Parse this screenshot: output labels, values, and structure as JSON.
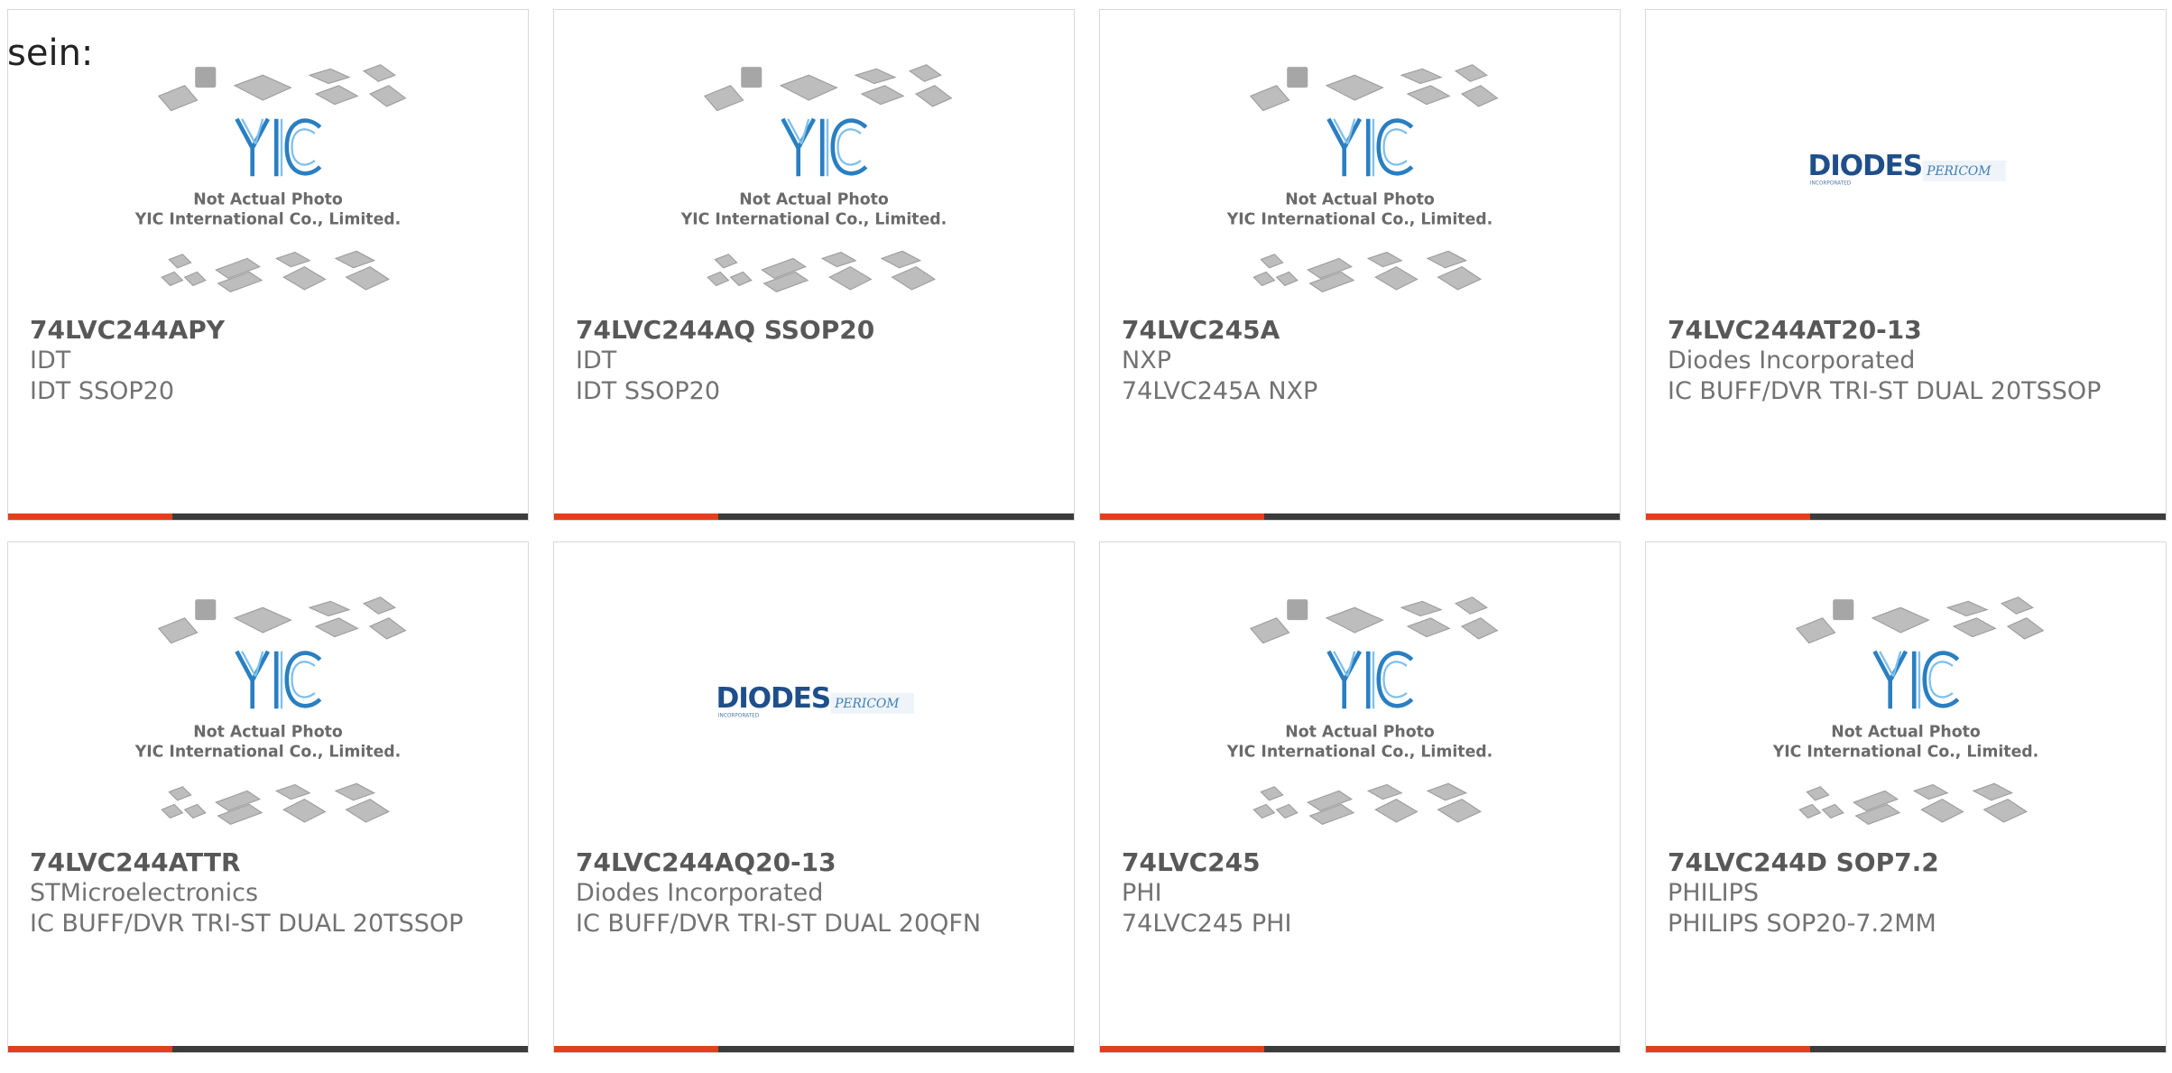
{
  "intro_text": "sein:",
  "placeholder": {
    "line1": "Not Actual Photo",
    "line2": "YIC International Co., Limited.",
    "logo_text": "YIC"
  },
  "diodes_logo": {
    "brand": "DIODES",
    "sub": "INCORPORATED",
    "partner": "PERICOM"
  },
  "colors": {
    "accent": "#e2401c",
    "bar": "#3c3c3c",
    "border": "#d8d8d8"
  },
  "products": [
    {
      "part": "74LVC244APY",
      "maker": "IDT",
      "desc": "IDT SSOP20",
      "image": "yic-placeholder"
    },
    {
      "part": "74LVC244AQ SSOP20",
      "maker": "IDT",
      "desc": "IDT SSOP20",
      "image": "yic-placeholder"
    },
    {
      "part": "74LVC245A",
      "maker": "NXP",
      "desc": "74LVC245A NXP",
      "image": "yic-placeholder"
    },
    {
      "part": "74LVC244AT20-13",
      "maker": "Diodes Incorporated",
      "desc": "IC BUFF/DVR TRI-ST DUAL 20TSSOP",
      "image": "diodes-logo"
    },
    {
      "part": "74LVC244ATTR",
      "maker": "STMicroelectronics",
      "desc": "IC BUFF/DVR TRI-ST DUAL 20TSSOP",
      "image": "yic-placeholder"
    },
    {
      "part": "74LVC244AQ20-13",
      "maker": "Diodes Incorporated",
      "desc": "IC BUFF/DVR TRI-ST DUAL 20QFN",
      "image": "diodes-logo"
    },
    {
      "part": "74LVC245",
      "maker": "PHI",
      "desc": "74LVC245 PHI",
      "image": "yic-placeholder"
    },
    {
      "part": "74LVC244D SOP7.2",
      "maker": "PHILIPS",
      "desc": "PHILIPS SOP20-7.2MM",
      "image": "yic-placeholder"
    }
  ]
}
